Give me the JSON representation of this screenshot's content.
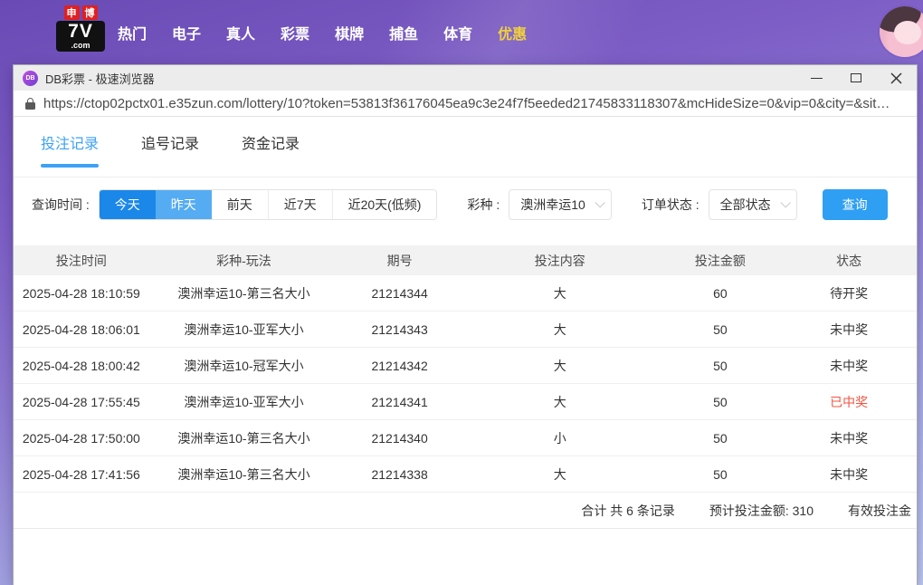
{
  "navbar": {
    "logo": {
      "badge1": "申",
      "badge2": "博",
      "main": "7V",
      "com": ".com"
    },
    "items": [
      {
        "label": "热门",
        "color": "#ffffff"
      },
      {
        "label": "电子",
        "color": "#ffffff"
      },
      {
        "label": "真人",
        "color": "#ffffff"
      },
      {
        "label": "彩票",
        "color": "#ffffff"
      },
      {
        "label": "棋牌",
        "color": "#ffffff"
      },
      {
        "label": "捕鱼",
        "color": "#ffffff"
      },
      {
        "label": "体育",
        "color": "#ffffff"
      },
      {
        "label": "优惠",
        "color": "#f0d03c"
      }
    ]
  },
  "window": {
    "icon_text": "DB",
    "title": "DB彩票 - 极速浏览器"
  },
  "address_bar": {
    "url": "https://ctop02pctx01.e35zun.com/lottery/10?token=53813f36176045ea9c3e24f7f5eeded21745833118307&mcHideSize=0&vip=0&city=&sit…"
  },
  "tabs": [
    {
      "label": "投注记录",
      "active": true
    },
    {
      "label": "追号记录",
      "active": false
    },
    {
      "label": "资金记录",
      "active": false
    }
  ],
  "filters": {
    "time_label": "查询时间 :",
    "time_options": [
      {
        "label": "今天",
        "selected": true,
        "bg": "#1b87e9"
      },
      {
        "label": "昨天",
        "selected": true,
        "bg": "#55acf2"
      },
      {
        "label": "前天",
        "selected": false
      },
      {
        "label": "近7天",
        "selected": false
      },
      {
        "label": "近20天(低频)",
        "selected": false
      }
    ],
    "lottery_label": "彩种 :",
    "lottery_value": "澳洲幸运10",
    "status_label": "订单状态 :",
    "status_value": "全部状态",
    "search_button": "查询",
    "search_button_color": "#2f9ff4"
  },
  "table": {
    "headers": [
      "投注时间",
      "彩种-玩法",
      "期号",
      "投注内容",
      "投注金额",
      "状态"
    ],
    "rows": [
      {
        "time": "2025-04-28 18:10:59",
        "game": "澳洲幸运10-第三名大小",
        "issue": "21214344",
        "content": "大",
        "amount": "60",
        "status": "待开奖",
        "status_color": "#333333"
      },
      {
        "time": "2025-04-28 18:06:01",
        "game": "澳洲幸运10-亚军大小",
        "issue": "21214343",
        "content": "大",
        "amount": "50",
        "status": "未中奖",
        "status_color": "#333333"
      },
      {
        "time": "2025-04-28 18:00:42",
        "game": "澳洲幸运10-冠军大小",
        "issue": "21214342",
        "content": "大",
        "amount": "50",
        "status": "未中奖",
        "status_color": "#333333"
      },
      {
        "time": "2025-04-28 17:55:45",
        "game": "澳洲幸运10-亚军大小",
        "issue": "21214341",
        "content": "大",
        "amount": "50",
        "status": "已中奖",
        "status_color": "#f25542"
      },
      {
        "time": "2025-04-28 17:50:00",
        "game": "澳洲幸运10-第三名大小",
        "issue": "21214340",
        "content": "小",
        "amount": "50",
        "status": "未中奖",
        "status_color": "#333333"
      },
      {
        "time": "2025-04-28 17:41:56",
        "game": "澳洲幸运10-第三名大小",
        "issue": "21214338",
        "content": "大",
        "amount": "50",
        "status": "未中奖",
        "status_color": "#333333"
      }
    ],
    "summary": {
      "total": "合计 共 6 条记录",
      "expected": "预计投注金额: 310",
      "valid": "有效投注金"
    }
  }
}
